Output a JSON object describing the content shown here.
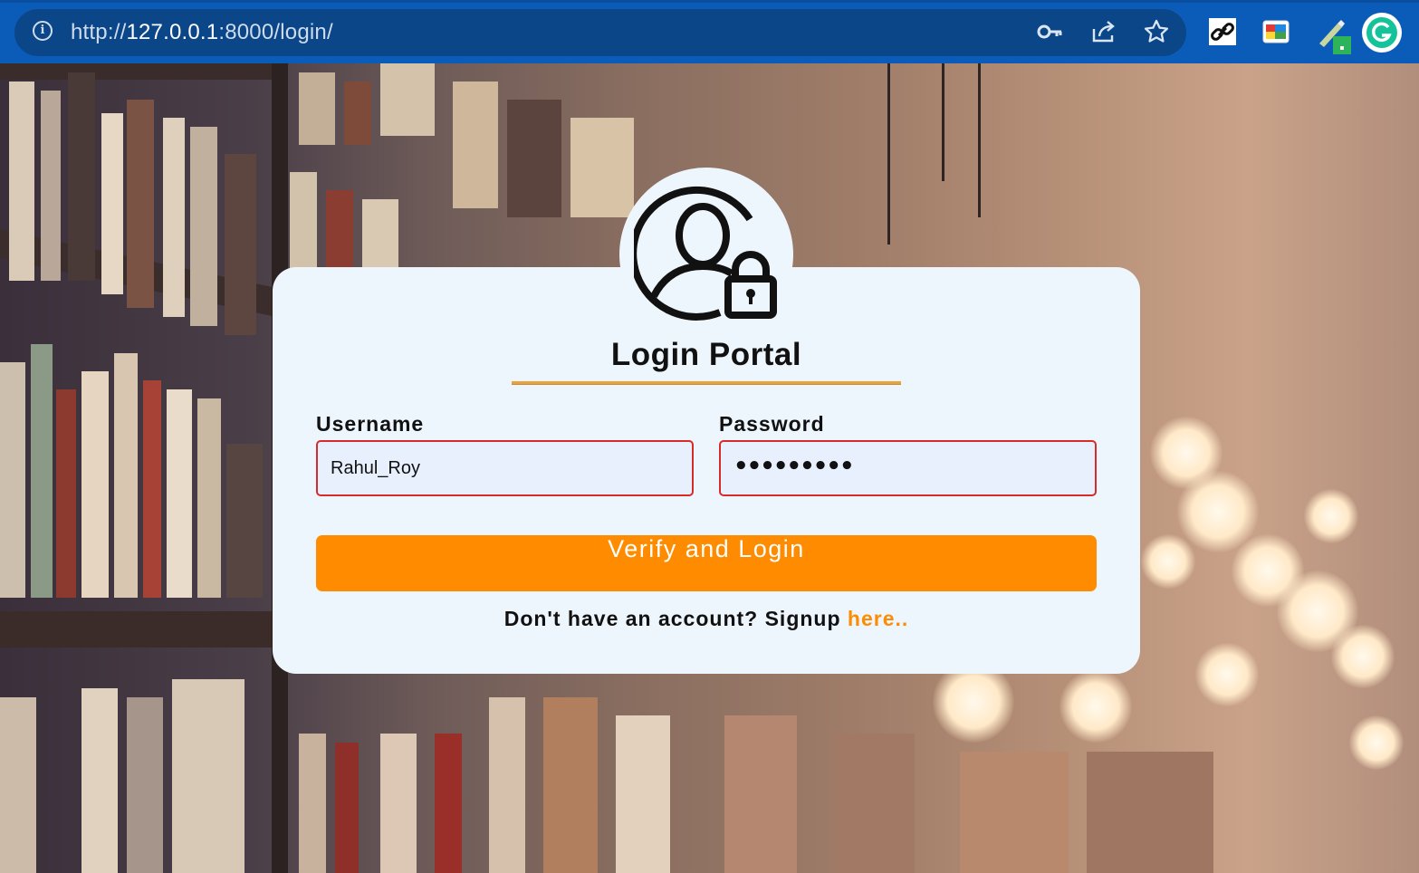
{
  "browser": {
    "url_prefix": "http://",
    "url_host": "127.0.0.1",
    "url_rest": ":8000/login/",
    "icons": [
      "info-icon",
      "key-icon",
      "share-icon",
      "star-icon",
      "link-extension-icon",
      "color-extension-icon",
      "pen-extension-icon",
      "grammarly-icon"
    ]
  },
  "login": {
    "title": "Login Portal",
    "username_label": "Username",
    "username_value": "Rahul_Roy",
    "password_label": "Password",
    "password_value": "•••••••••",
    "submit_label": "Verify and Login",
    "signup_text": "Don't have an account? Signup ",
    "signup_link": "here.."
  },
  "colors": {
    "accent": "#ff8c00",
    "card_bg": "#eef6fd",
    "field_border": "#d52b2b",
    "chrome_bg": "#0b5cb8"
  }
}
